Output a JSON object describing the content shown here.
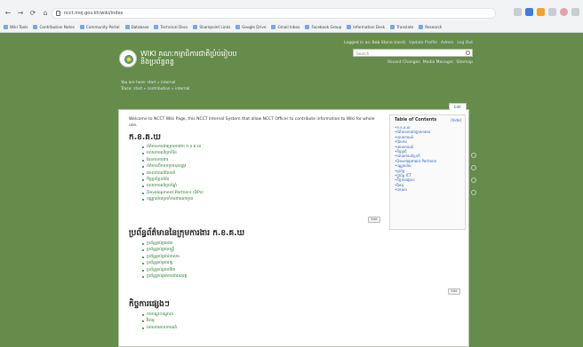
{
  "browser": {
    "nav": [
      "←",
      "→",
      "⟳",
      "⌂"
    ],
    "url": "ncct.moj.gov.kh/wiki/index",
    "bookmarks": [
      "Wiki Tools",
      "Contribution Notes",
      "Community Portal",
      "Database",
      "Technical Docs",
      "Sharepoint Links",
      "Google Drive",
      "Gmail Inbox",
      "Facebook Group",
      "Information Desk",
      "Translate",
      "Research"
    ]
  },
  "header": {
    "site_title_line1": "WIKI គណៈកម្មាធិការជាតិប្រំប់រៀបប",
    "site_title_line2": "និងប្រព័ន្ធពន្ធ",
    "user_links": [
      "Logged in as: Bob Stone (ncct)",
      "Update Profile",
      "Admin",
      "Log Out"
    ],
    "search_placeholder": "Search",
    "util_links": [
      "Recent Changes",
      "Media Manager",
      "Sitemap"
    ]
  },
  "crumbs": {
    "you_are_here_label": "You are here:",
    "you_are_here": "start » internal",
    "trace_label": "Trace:",
    "trace": "start » contribution » internal"
  },
  "content": {
    "edit_label": "Edit",
    "intro": "Welcome to NCCT Wiki Page, this NCCT Internal System that allow NCCT Officer to contribute information to Wiki for whole use.",
    "section1": {
      "title": "ក.ខ.គ.ឃ",
      "items": [
        "ព័ត៌មានការងារក្រុមការងារ ក.ខ.គ.ឃ",
        "របាយការណ៍ប្រចាំខែ",
        "ផែនការការងារ",
        "ព័ត៌មានពីការទទួលខុសត្រូវ",
        "គោលការណ៍ណែនាំ",
        "កិច្ចប្រជុំប្រចាំខែ",
        "របាយការណ៍ប្រចាំឆ្នាំ",
        "Development Partners (DPs)",
        "បណ្ណាល័យប្រចាំការងារណាមួយ"
      ],
      "edit_btn": "Edit"
    },
    "section2": {
      "title": "ប្រព័ន្ធព័ត៌មាននៃក្រុមការងារ ក.ខ.គ.ឃ",
      "items": [
        "ប្រព័ន្ធគ្រប់គ្រងងារ",
        "ប្រព័ន្ធគ្រប់គ្រងមន្ត្រី",
        "ប្រព័ន្ធគ្រប់គ្រងឯកសារ",
        "ប្រព័ន្ធគ្រប់គ្រងរក្ស",
        "ប្រព័ន្ធគ្រប់គ្រងថវិកា",
        "ប្រព័ន្ធគ្រប់គ្រងការងារអនុវត្ត"
      ],
      "edit_btn": "Edit"
    },
    "section3": {
      "title": "កិច្ចការផ្សេងៗ",
      "items": [
        "ការបណ្តុះបណ្តាល",
        "វីដេអូ",
        "ឯកសារគោលការណ៍"
      ]
    },
    "toc": {
      "title": "Table of Contents",
      "hide_label": "[hide]",
      "items": [
        "ក.ខ.គ.ឃ",
        "ព័ត៌មានការងារក្រុមការងារ",
        "របាយការណ៍",
        "ផែនការ",
        "គោលការណ៍",
        "កិច្ចប្រជុំ",
        "របាយការណ៍ប្រចាំ",
        "Development Partners",
        "បណ្ណាល័យ",
        "ប្រព័ន្ធ",
        "ប្រព័ន្ធ ICT",
        "កិច្ចការផ្សេងៗ",
        "វីដេអូ",
        "ឯកសារ"
      ]
    }
  }
}
